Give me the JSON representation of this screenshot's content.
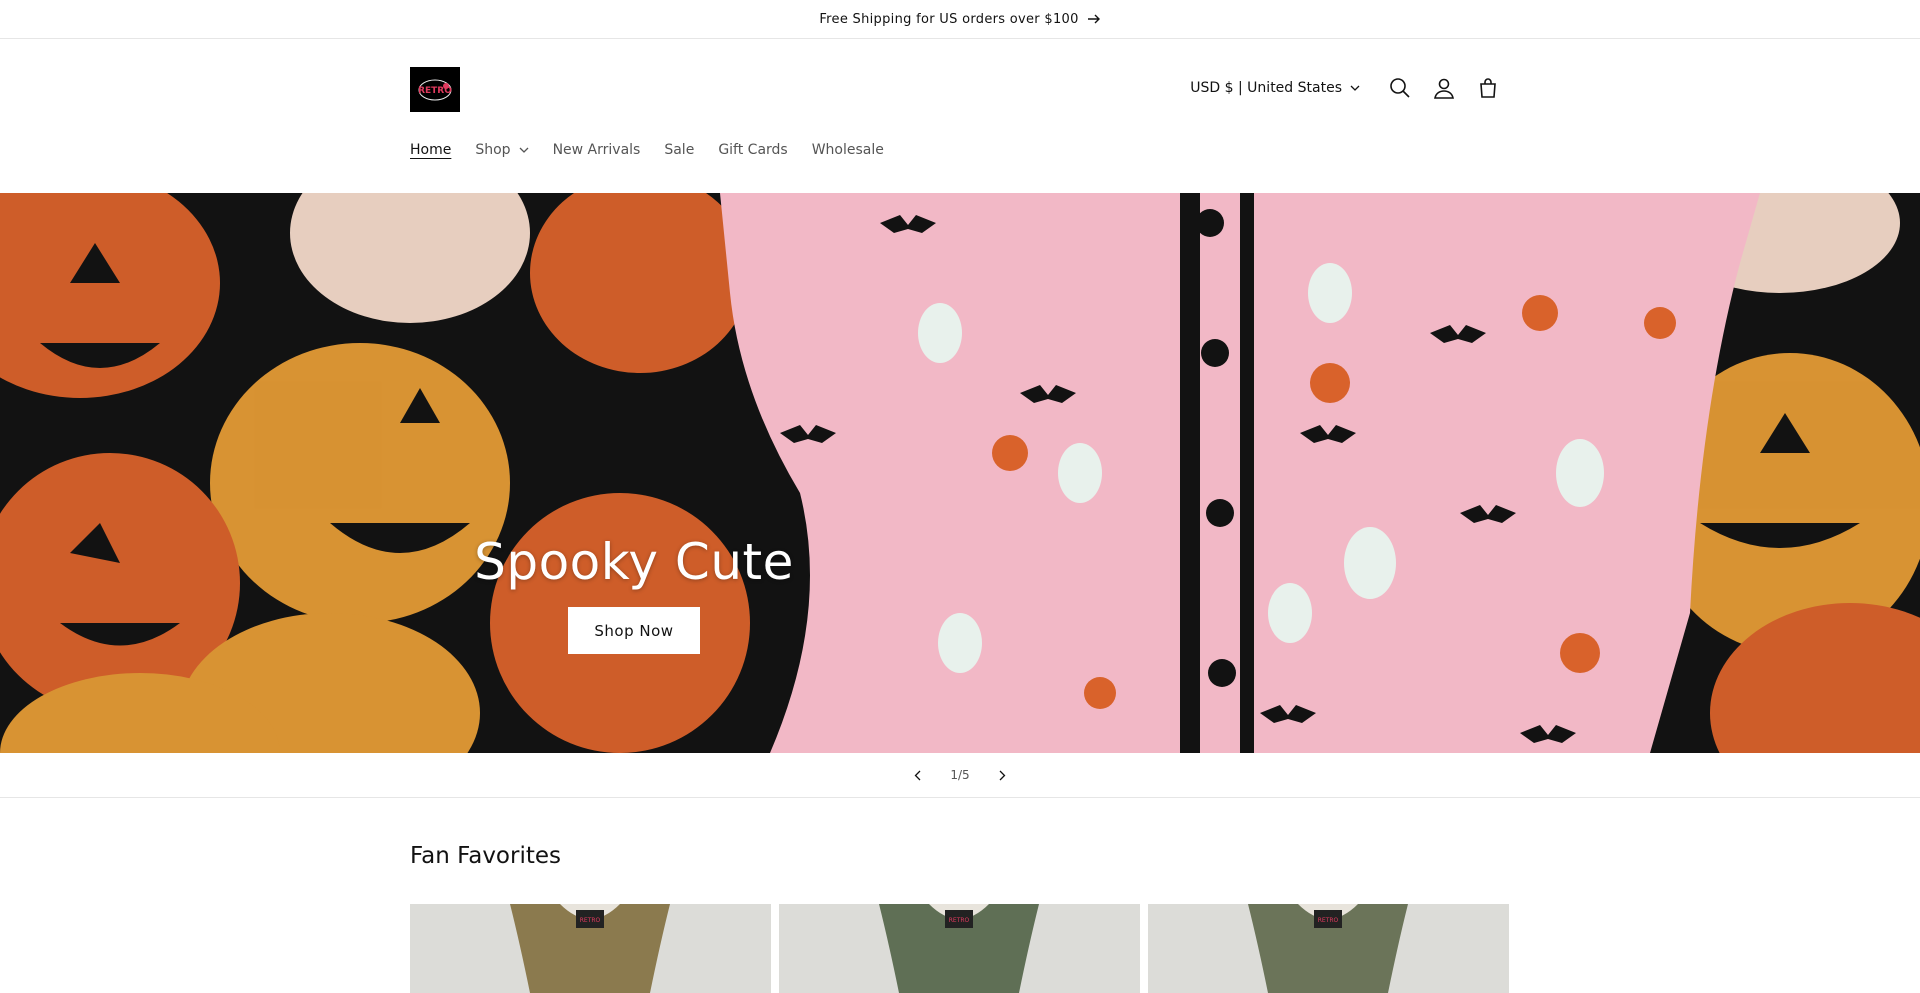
{
  "announcement": {
    "text": "Free Shipping for US orders over $100",
    "icon": "arrow-right-icon"
  },
  "header": {
    "logo_text": "RETRO",
    "currency": "USD $ | United States",
    "icons": [
      "search-icon",
      "account-icon",
      "cart-icon"
    ]
  },
  "nav": {
    "items": [
      {
        "label": "Home"
      },
      {
        "label": "Shop"
      },
      {
        "label": "New Arrivals"
      },
      {
        "label": "Sale"
      },
      {
        "label": "Gift Cards"
      },
      {
        "label": "Wholesale"
      }
    ]
  },
  "hero": {
    "title": "Spooky Cute",
    "button_label": "Shop Now"
  },
  "slider": {
    "current": "1",
    "separator": "/",
    "total": "5"
  },
  "featured": {
    "title": "Fan Favorites",
    "products": [
      {
        "label_text": "RETRO"
      },
      {
        "label_text": "RETRO"
      },
      {
        "label_text": "RETRO"
      }
    ]
  },
  "colors": {
    "pink_fabric": "#f2b8c6",
    "pumpkin_orange": "#d9622b",
    "pumpkin_amber": "#e39a35",
    "background_dark": "#111111"
  }
}
